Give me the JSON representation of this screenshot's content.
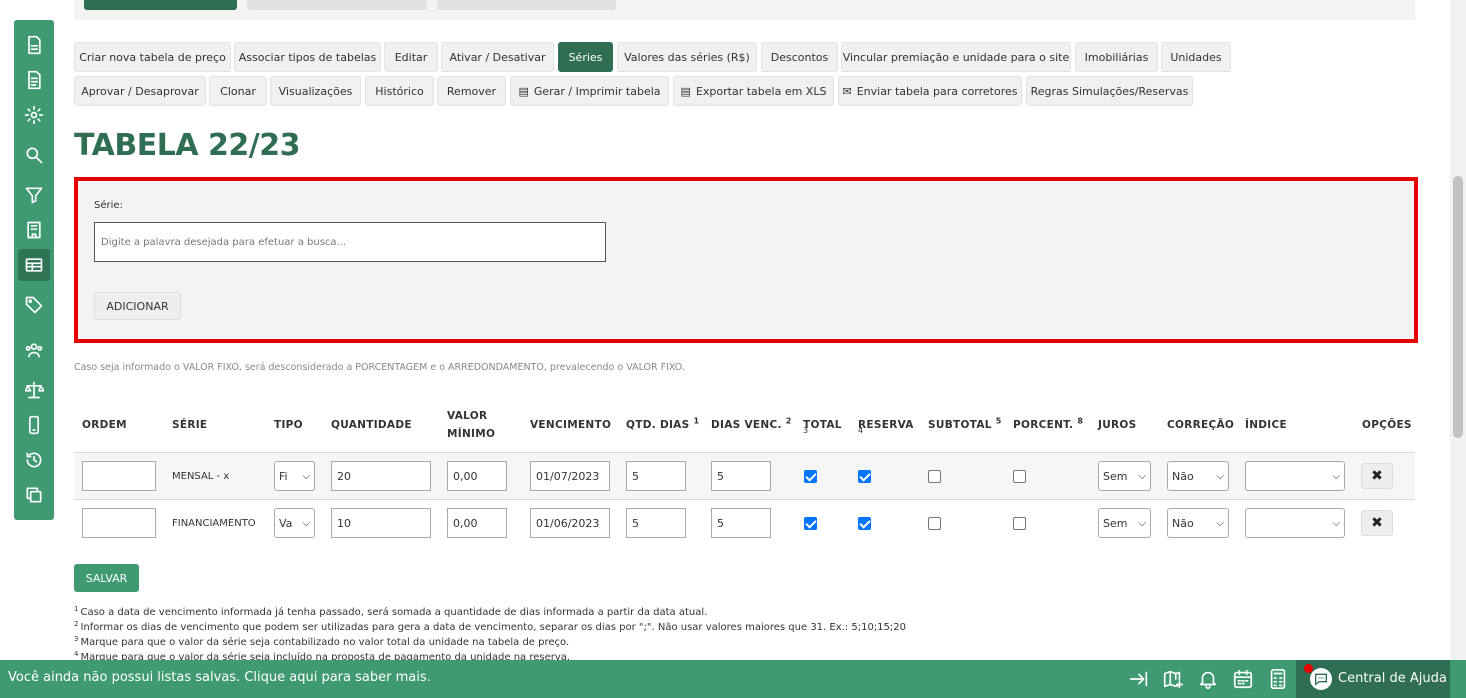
{
  "toolbar": {
    "row1": [
      "Criar nova tabela de preço",
      "Associar tipos de tabelas",
      "Editar",
      "Ativar / Desativar",
      "Séries",
      "Valores das séries (R$)",
      "Descontos",
      "Vincular premiação e unidade para o site",
      "Imobiliárias",
      "Unidades"
    ],
    "row2": [
      "Aprovar / Desaprovar",
      "Clonar",
      "Visualizações",
      "Histórico",
      "Remover",
      "Gerar / Imprimir tabela",
      "Exportar tabela em XLS",
      "Enviar tabela para corretores",
      "Regras Simulações/Reservas"
    ],
    "active": "Séries"
  },
  "page_title": "TABELA 22/23",
  "search": {
    "label": "Série:",
    "placeholder": "Digite a palavra desejada para efetuar a busca...",
    "add_label": "ADICIONAR"
  },
  "note": "Caso seja informado o VALOR FIXO, será desconsiderado a PORCENTAGEM e o ARREDONDAMENTO, prevalecendo o VALOR FIXO.",
  "table": {
    "headers": {
      "ordem": "ORDEM",
      "serie": "SÉRIE",
      "tipo": "TIPO",
      "quantidade": "QUANTIDADE",
      "valor_minimo_1": "VALOR",
      "valor_minimo_2": "MÍNIMO",
      "vencimento": "VENCIMENTO",
      "qtd_dias": "QTD. DIAS",
      "qtd_dias_sup": "1",
      "dias_venc": "DIAS VENC.",
      "dias_venc_sup": "2",
      "total": "TOTAL",
      "total_sup": "3",
      "reserva": "RESERVA",
      "reserva_sup": "4",
      "subtotal": "SUBTOTAL",
      "subtotal_sup": "5",
      "porcent": "PORCENT.",
      "porcent_sup": "8",
      "juros": "JUROS",
      "correcao": "CORREÇÃO",
      "indice": "ÍNDICE",
      "opcoes": "OPÇÕES"
    },
    "rows": [
      {
        "ordem": "",
        "serie": "MENSAL - x",
        "tipo": "Fi",
        "quantidade": "20",
        "valor_minimo": "0,00",
        "vencimento": "01/07/2023",
        "qtd_dias": "5",
        "dias_venc": "5",
        "total": true,
        "reserva": true,
        "subtotal": false,
        "porcent": false,
        "juros": "Sem",
        "correcao": "Não",
        "indice": ""
      },
      {
        "ordem": "",
        "serie": "FINANCIAMENTO",
        "tipo": "Va",
        "quantidade": "10",
        "valor_minimo": "0,00",
        "vencimento": "01/06/2023",
        "qtd_dias": "5",
        "dias_venc": "5",
        "total": true,
        "reserva": true,
        "subtotal": false,
        "porcent": false,
        "juros": "Sem",
        "correcao": "Não",
        "indice": ""
      }
    ]
  },
  "save_label": "SALVAR",
  "footnotes": [
    {
      "n": "1",
      "text": "Caso a data de vencimento informada já tenha passado, será somada a quantidade de dias informada a partir da data atual."
    },
    {
      "n": "2",
      "text": "Informar os dias de vencimento que podem ser utilizadas para gera a data de vencimento, separar os dias por \";\". Não usar valores maiores que 31. Ex.: 5;10;15;20"
    },
    {
      "n": "3",
      "text": "Marque para que o valor da série seja contabilizado no valor total da unidade na tabela de preço."
    },
    {
      "n": "4",
      "text": "Marque para que o valor da série seja incluído na proposta de pagamento da unidade na reserva."
    }
  ],
  "bottom_bar": {
    "message": "Você ainda não possui listas salvas. Clique aqui para saber mais.",
    "help_label": "Central de Ajuda",
    "icons": [
      "collapse-right-icon",
      "map-plus-icon",
      "bell-icon",
      "calendar-icon",
      "calculator-icon",
      "help-chat-icon"
    ]
  },
  "sidebar": {
    "icons": [
      "document-icon",
      "document-lines-icon",
      "gear-icon",
      "search-icon",
      "filter-icon",
      "building-icon",
      "table-icon",
      "tag-icon",
      "users-icon",
      "scale-icon",
      "mobile-icon",
      "history-icon",
      "copy-icon"
    ],
    "active_index": 6
  },
  "colors": {
    "brand_green": "#3f9a71",
    "dark_green": "#2f6e52",
    "highlight_red": "#e60000",
    "checkbox_blue": "#0075ff"
  }
}
